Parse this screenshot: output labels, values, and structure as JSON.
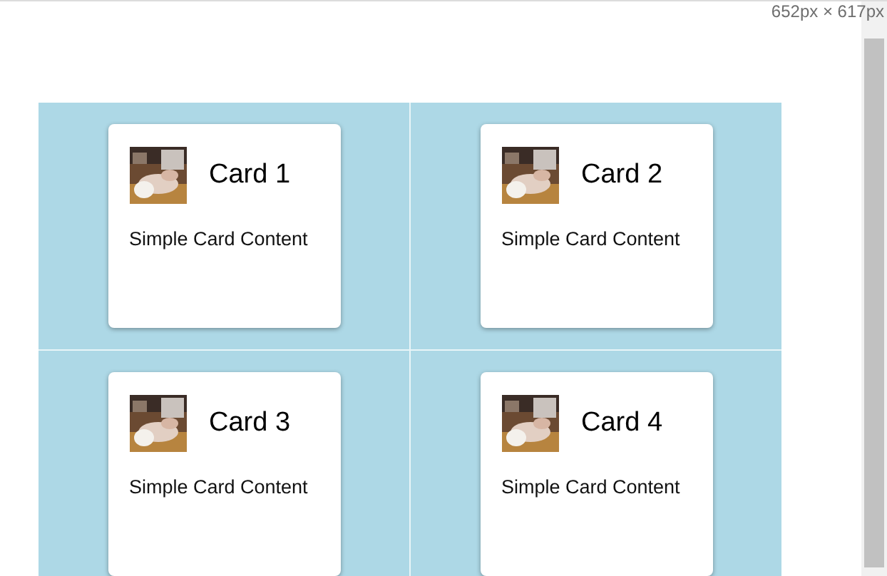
{
  "viewport_size": "652px × 617px",
  "cards": [
    {
      "title": "Card 1",
      "content": "Simple Card Content"
    },
    {
      "title": "Card 2",
      "content": "Simple Card Content"
    },
    {
      "title": "Card 3",
      "content": "Simple Card Content"
    },
    {
      "title": "Card 4",
      "content": "Simple Card Content"
    }
  ]
}
